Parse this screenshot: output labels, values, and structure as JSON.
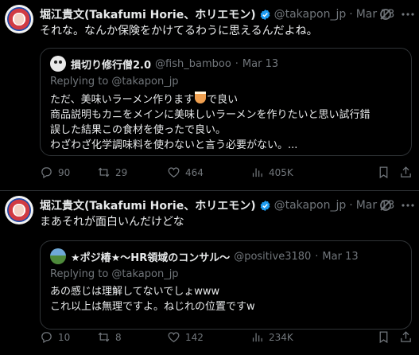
{
  "tweets": [
    {
      "author_name": "堀江貴文(Takafumi Horie、ホリエモン)",
      "handle": "@takapon_jp",
      "dot": "·",
      "date": "Mar 13",
      "text": "それな。なんか保険をかけてるわうに思えるんだよね。",
      "quote": {
        "author_name": "損切り修行僧2.0",
        "handle": "@fish_bamboo",
        "dot": "·",
        "date": "Mar 13",
        "replying": "Replying to @takapon_jp",
        "line1_pre": "ただ、美味いラーメン作ります",
        "line1_post": "で良い",
        "line2": "商品説明もカニをメインに美味しいラーメンを作りたいと思い試行錯",
        "line3": "誤した結果この食材を使ったで良い。",
        "line4": "わざわざ化学調味料を使わないと言う必要がない。..."
      },
      "stats": {
        "replies": "90",
        "retweets": "29",
        "likes": "464",
        "views": "405K"
      }
    },
    {
      "author_name": "堀江貴文(Takafumi Horie、ホリエモン)",
      "handle": "@takapon_jp",
      "dot": "·",
      "date": "Mar 13",
      "text": "まあそれが面白いんだけどな",
      "quote": {
        "author_name": "★ポジ椿★〜HR領域のコンサル〜",
        "handle": "@positive3180",
        "dot": "·",
        "date": "Mar 13",
        "replying": "Replying to @takapon_jp",
        "line1": "あの感じは理解してないでしょwww",
        "line2": "これ以上は無理ですよ。ねじれの位置ですw"
      },
      "stats": {
        "replies": "10",
        "retweets": "8",
        "likes": "142",
        "views": "234K"
      }
    }
  ],
  "colors": {
    "background": "#000000",
    "text": "#e7e9ea",
    "muted": "#71767b",
    "border": "#2f3336",
    "verified": "#1d9bf0"
  }
}
